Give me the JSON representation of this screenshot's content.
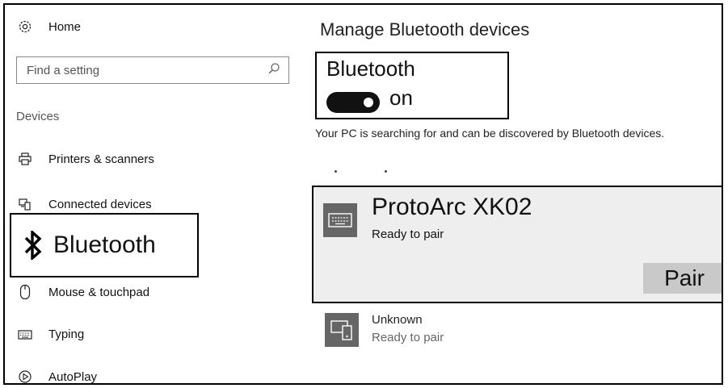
{
  "sidebar": {
    "home_label": "Home",
    "search_placeholder": "Find a setting",
    "section_label": "Devices",
    "items": [
      {
        "label": "Printers & scanners",
        "icon": "printer-icon"
      },
      {
        "label": "Connected devices",
        "icon": "connected-devices-icon"
      },
      {
        "label": "Bluetooth",
        "icon": "bluetooth-icon",
        "selected": true
      },
      {
        "label": "Mouse & touchpad",
        "icon": "mouse-icon"
      },
      {
        "label": "Typing",
        "icon": "keyboard-icon"
      },
      {
        "label": "AutoPlay",
        "icon": "autoplay-icon"
      }
    ]
  },
  "main": {
    "title": "Manage Bluetooth devices",
    "bluetooth_label": "Bluetooth",
    "toggle_state": "on",
    "description": "Your PC is searching for and can be discovered by Bluetooth devices.",
    "devices": [
      {
        "name": "ProtoArc XK02",
        "status": "Ready to pair",
        "action": "Pair",
        "icon": "keyboard-icon"
      },
      {
        "name": "Unknown",
        "status": "Ready to pair",
        "icon": "device-icon"
      }
    ]
  },
  "colors": {
    "card_bg": "#eeeeee",
    "pair_button_bg": "#c9c9c9",
    "icon_bg": "#666666"
  }
}
